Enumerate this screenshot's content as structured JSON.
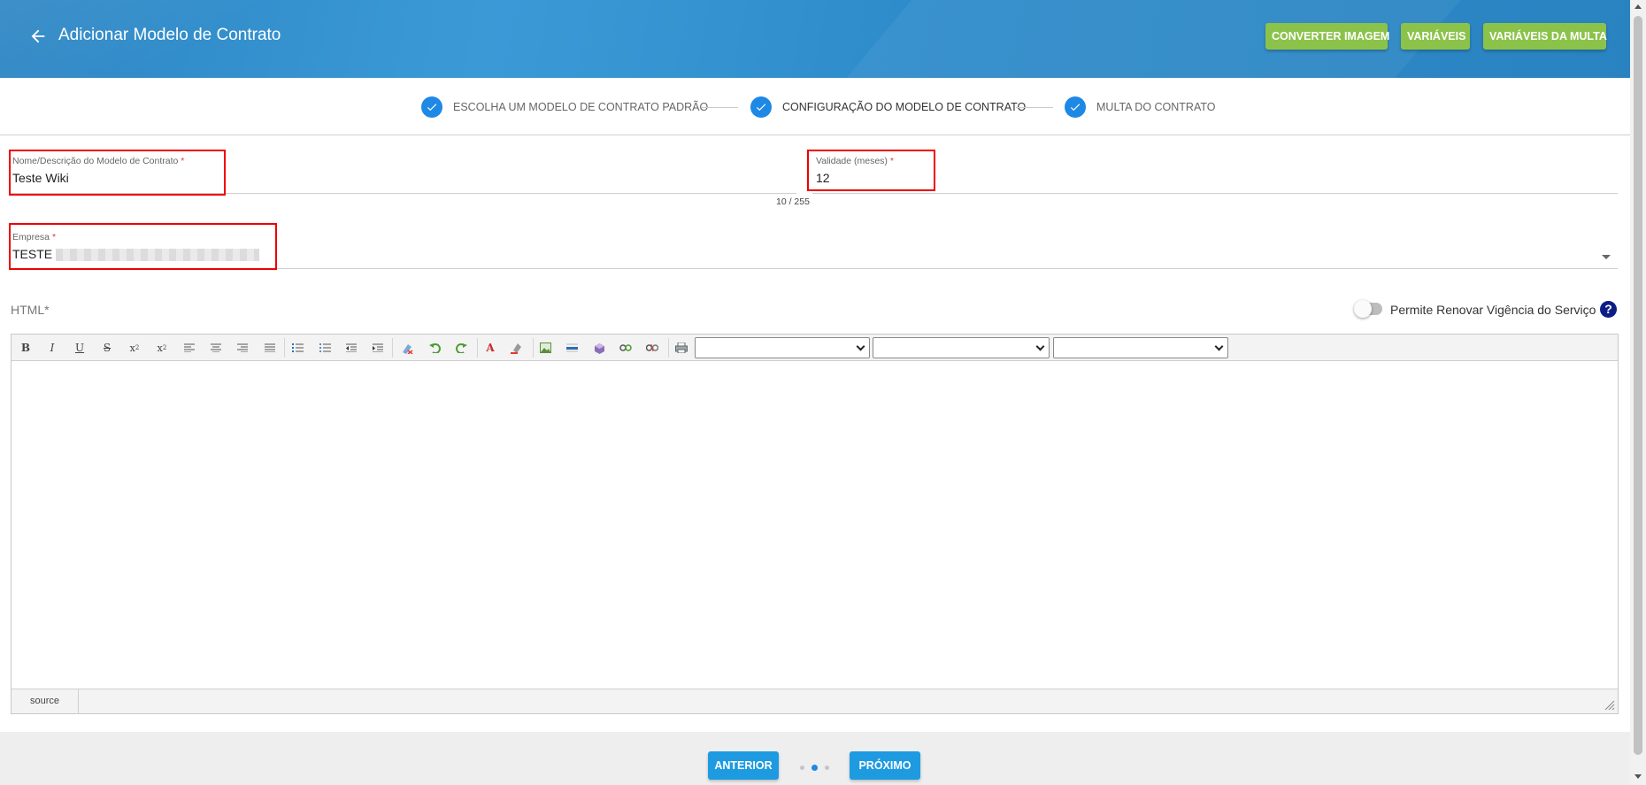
{
  "header": {
    "title": "Adicionar Modelo de Contrato",
    "buttons": {
      "converter": "CONVERTER IMAGEM",
      "variaveis": "VARIÁVEIS",
      "multa": "VARIÁVEIS DA MULTA"
    },
    "accent_color": "#2d86c4",
    "button_color": "#8bc34a"
  },
  "stepper": {
    "steps": [
      {
        "label": "ESCOLHA UM MODELO DE CONTRATO PADRÃO",
        "status": "done"
      },
      {
        "label": "CONFIGURAÇÃO DO MODELO DE CONTRATO",
        "status": "active"
      },
      {
        "label": "MULTA DO CONTRATO",
        "status": "done"
      }
    ],
    "icon": "check-icon",
    "color": "#1e88e5"
  },
  "form": {
    "nome": {
      "label": "Nome/Descrição do Modelo de Contrato",
      "required": "*",
      "value": "Teste Wiki",
      "counter": "10 / 255"
    },
    "validade": {
      "label": "Validade (meses)",
      "required": "*",
      "value": "12"
    },
    "empresa": {
      "label": "Empresa",
      "required": "*",
      "value": "TESTE"
    },
    "html_label": "HTML*",
    "toggle_label": "Permite Renovar Vigência do Serviço",
    "help": "?"
  },
  "editor": {
    "toolbar_icons": [
      "bold-icon",
      "italic-icon",
      "underline-icon",
      "strikethrough-icon",
      "subscript-icon",
      "superscript-icon",
      "align-left-icon",
      "align-center-icon",
      "align-right-icon",
      "align-justify-icon",
      "ordered-list-icon",
      "unordered-list-icon",
      "outdent-icon",
      "indent-icon",
      "remove-format-icon",
      "undo-icon",
      "redo-icon",
      "text-color-icon",
      "background-color-icon",
      "image-icon",
      "horizontal-rule-icon",
      "insert-object-icon",
      "link-icon",
      "unlink-icon",
      "print-icon"
    ],
    "toolbar_glyphs": {
      "bold": "B",
      "italic": "I",
      "underline": "U",
      "strike": "S",
      "sub": "x",
      "sup": "x"
    },
    "status_source": "source"
  },
  "footer": {
    "prev": "ANTERIOR",
    "next": "PRÓXIMO",
    "pages": 3,
    "current_page": 2
  }
}
